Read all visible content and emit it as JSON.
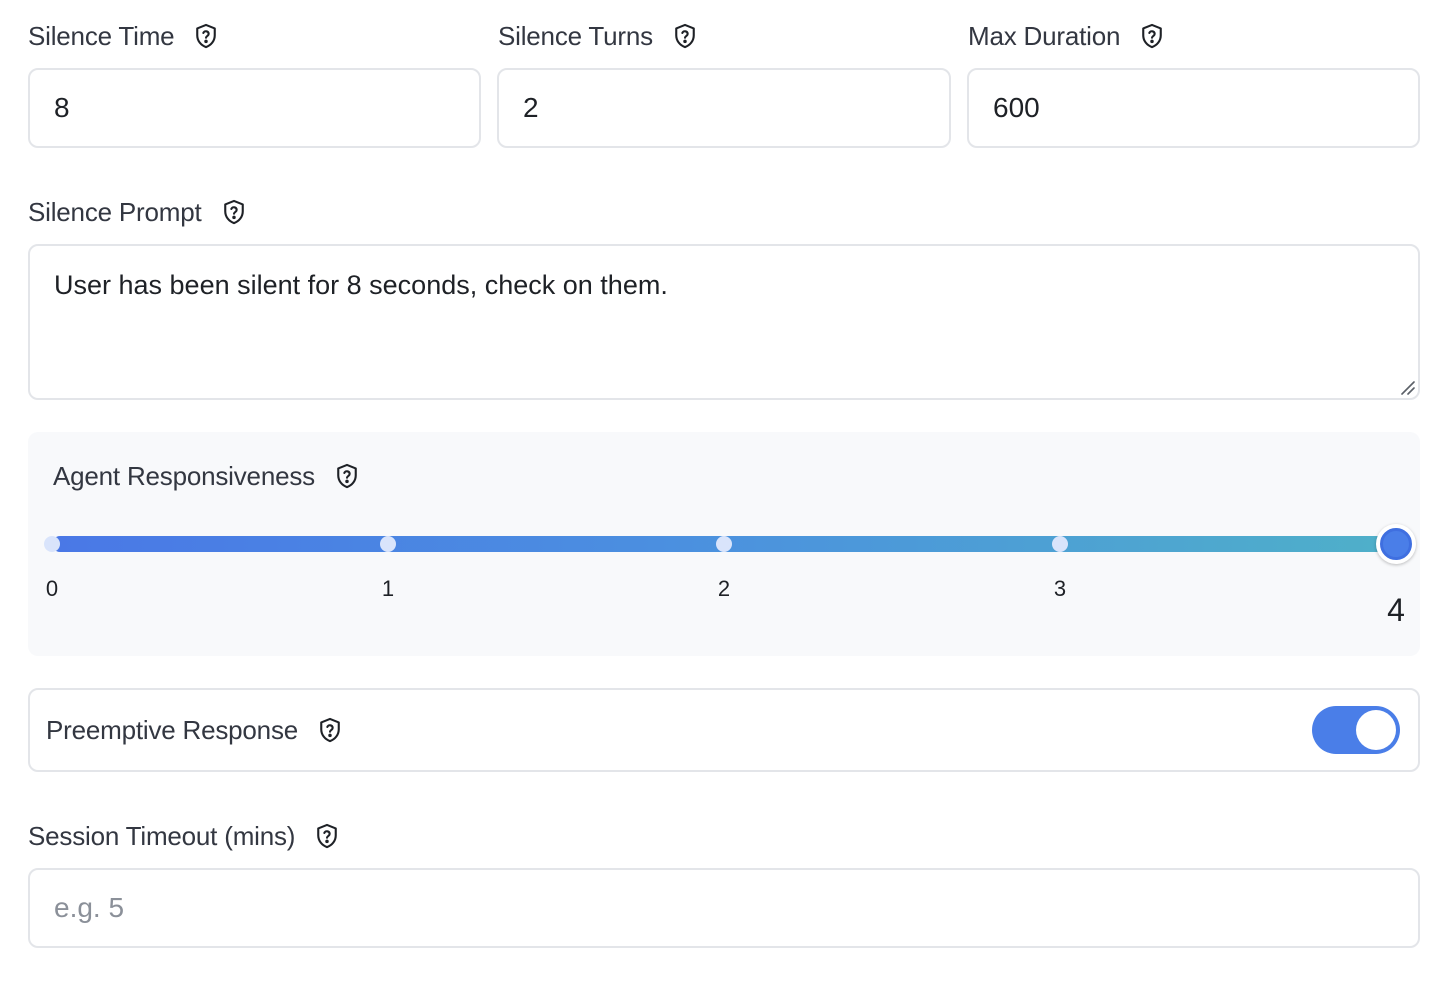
{
  "fields": {
    "silence_time": {
      "label": "Silence Time",
      "value": "8"
    },
    "silence_turns": {
      "label": "Silence Turns",
      "value": "2"
    },
    "max_duration": {
      "label": "Max Duration",
      "value": "600"
    },
    "silence_prompt": {
      "label": "Silence Prompt",
      "value": "User has been silent for 8 seconds, check on them."
    },
    "session_timeout": {
      "label": "Session Timeout (mins)",
      "value": "",
      "placeholder": "e.g. 5"
    }
  },
  "responsiveness": {
    "label": "Agent Responsiveness",
    "min": 0,
    "max": 4,
    "value": 4,
    "ticks": [
      "0",
      "1",
      "2",
      "3",
      "4"
    ]
  },
  "preemptive": {
    "label": "Preemptive Response",
    "enabled": true
  },
  "icons": {
    "help": "shield-question-icon"
  },
  "colors": {
    "accent": "#4a7ee8",
    "track_start": "#4a78e6",
    "track_end": "#4fb0c9",
    "panel_bg": "#f8f9fb",
    "border": "#e3e5e9"
  }
}
